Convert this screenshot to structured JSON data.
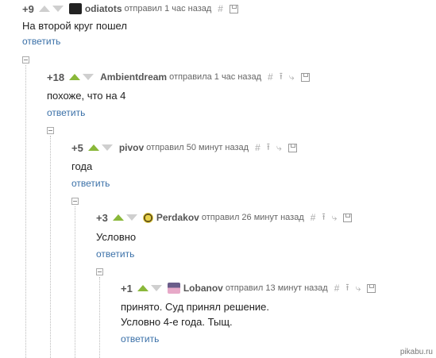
{
  "comments": [
    {
      "rating": "+9",
      "author": "odiatots",
      "meta": "отправил 1 час назад",
      "text_lines": [
        "На второй круг пошел"
      ],
      "reply": "ответить"
    },
    {
      "rating": "+18",
      "author": "Ambientdream",
      "meta": "отправила 1 час назад",
      "text_lines": [
        "похоже, что на 4"
      ],
      "reply": "ответить"
    },
    {
      "rating": "+5",
      "author": "pivov",
      "meta": "отправил 50 минут назад",
      "text_lines": [
        "года"
      ],
      "reply": "ответить"
    },
    {
      "rating": "+3",
      "author": "Perdakov",
      "meta": "отправил 26 минут назад",
      "text_lines": [
        "Условно"
      ],
      "reply": "ответить"
    },
    {
      "rating": "+1",
      "author": "Lobanov",
      "meta": "отправил 13 минут назад",
      "text_lines": [
        "принято. Суд принял решение.",
        "Условно 4-е года. Тыщ."
      ],
      "reply": "ответить"
    }
  ],
  "tools": {
    "hash": "#",
    "up": "⭱",
    "branch": "⤷"
  },
  "watermark": "pikabu.ru",
  "colors": {
    "vote_up": "#8ab83a",
    "vote_neutral": "#cfcfcf",
    "link": "#3a70a8"
  }
}
